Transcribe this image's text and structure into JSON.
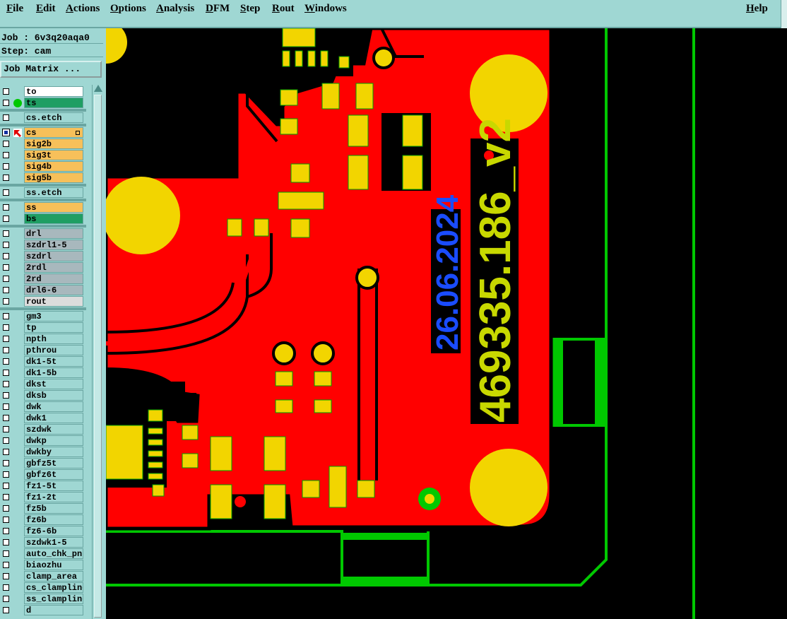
{
  "menu": {
    "file": "File",
    "edit": "Edit",
    "actions": "Actions",
    "options": "Options",
    "analysis": "Analysis",
    "dfm": "DFM",
    "step": "Step",
    "rout": "Rout",
    "windows": "Windows",
    "help": "Help"
  },
  "job": {
    "line": "Job : 6v3q20aqa0"
  },
  "step": {
    "line": "Step: cam"
  },
  "job_matrix_button": "Job Matrix ...",
  "layers": [
    {
      "name": "to",
      "color": "#ffffff",
      "checked": false
    },
    {
      "name": "ts",
      "color": "#1f9e63",
      "checked": false,
      "mark": "green-dot"
    },
    {
      "name": "cs.etch",
      "color": "#9fd7d3",
      "checked": false
    },
    {
      "name": "cs",
      "color": "#f7c05a",
      "checked": true,
      "mark": "arrow",
      "expand": true
    },
    {
      "name": "sig2b",
      "color": "#f7c05a",
      "checked": false
    },
    {
      "name": "sig3t",
      "color": "#f7c05a",
      "checked": false
    },
    {
      "name": "sig4b",
      "color": "#f7c05a",
      "checked": false
    },
    {
      "name": "sig5b",
      "color": "#f7c05a",
      "checked": false
    },
    {
      "name": "ss.etch",
      "color": "#9fd7d3",
      "checked": false
    },
    {
      "name": "ss",
      "color": "#f7c05a",
      "checked": false
    },
    {
      "name": "bs",
      "color": "#1f9e63",
      "checked": false
    },
    {
      "name": "drl",
      "color": "#a8b8bd",
      "checked": false
    },
    {
      "name": "szdrl1-5",
      "color": "#a8b8bd",
      "checked": false
    },
    {
      "name": "szdrl",
      "color": "#a8b8bd",
      "checked": false
    },
    {
      "name": "2rdl",
      "color": "#a8b8bd",
      "checked": false
    },
    {
      "name": "2rd",
      "color": "#a8b8bd",
      "checked": false
    },
    {
      "name": "drl6-6",
      "color": "#a8b8bd",
      "checked": false
    },
    {
      "name": "rout",
      "color": "#dcdcdc",
      "checked": false
    },
    {
      "name": "gm3",
      "color": "#9fd7d3",
      "checked": false
    },
    {
      "name": "tp",
      "color": "#9fd7d3",
      "checked": false
    },
    {
      "name": "npth",
      "color": "#9fd7d3",
      "checked": false
    },
    {
      "name": "pthrou",
      "color": "#9fd7d3",
      "checked": false
    },
    {
      "name": "dk1-5t",
      "color": "#9fd7d3",
      "checked": false
    },
    {
      "name": "dk1-5b",
      "color": "#9fd7d3",
      "checked": false
    },
    {
      "name": "dkst",
      "color": "#9fd7d3",
      "checked": false
    },
    {
      "name": "dksb",
      "color": "#9fd7d3",
      "checked": false
    },
    {
      "name": "dwk",
      "color": "#9fd7d3",
      "checked": false
    },
    {
      "name": "dwk1",
      "color": "#9fd7d3",
      "checked": false
    },
    {
      "name": "szdwk",
      "color": "#9fd7d3",
      "checked": false
    },
    {
      "name": "dwkp",
      "color": "#9fd7d3",
      "checked": false
    },
    {
      "name": "dwkby",
      "color": "#9fd7d3",
      "checked": false
    },
    {
      "name": "gbfz5t",
      "color": "#9fd7d3",
      "checked": false
    },
    {
      "name": "gbfz6t",
      "color": "#9fd7d3",
      "checked": false
    },
    {
      "name": "fz1-5t",
      "color": "#9fd7d3",
      "checked": false
    },
    {
      "name": "fz1-2t",
      "color": "#9fd7d3",
      "checked": false
    },
    {
      "name": "fz5b",
      "color": "#9fd7d3",
      "checked": false
    },
    {
      "name": "fz6b",
      "color": "#9fd7d3",
      "checked": false
    },
    {
      "name": "fz6-6b",
      "color": "#9fd7d3",
      "checked": false
    },
    {
      "name": "szdwk1-5",
      "color": "#9fd7d3",
      "checked": false
    },
    {
      "name": "auto_chk_pn",
      "color": "#9fd7d3",
      "checked": false
    },
    {
      "name": "biaozhu",
      "color": "#9fd7d3",
      "checked": false
    },
    {
      "name": "clamp_area",
      "color": "#9fd7d3",
      "checked": false
    },
    {
      "name": "cs_clampline",
      "color": "#9fd7d3",
      "checked": false
    },
    {
      "name": "ss_clampline",
      "color": "#9fd7d3",
      "checked": false
    },
    {
      "name": "d",
      "color": "#9fd7d3",
      "checked": false
    }
  ],
  "board_text": {
    "date": "26.06.2024",
    "part": "469335.186_v2"
  },
  "colors": {
    "copper": "#ff0000",
    "pad": "#f2d500",
    "outline": "#00c800",
    "date_text": "#1a4cff"
  }
}
